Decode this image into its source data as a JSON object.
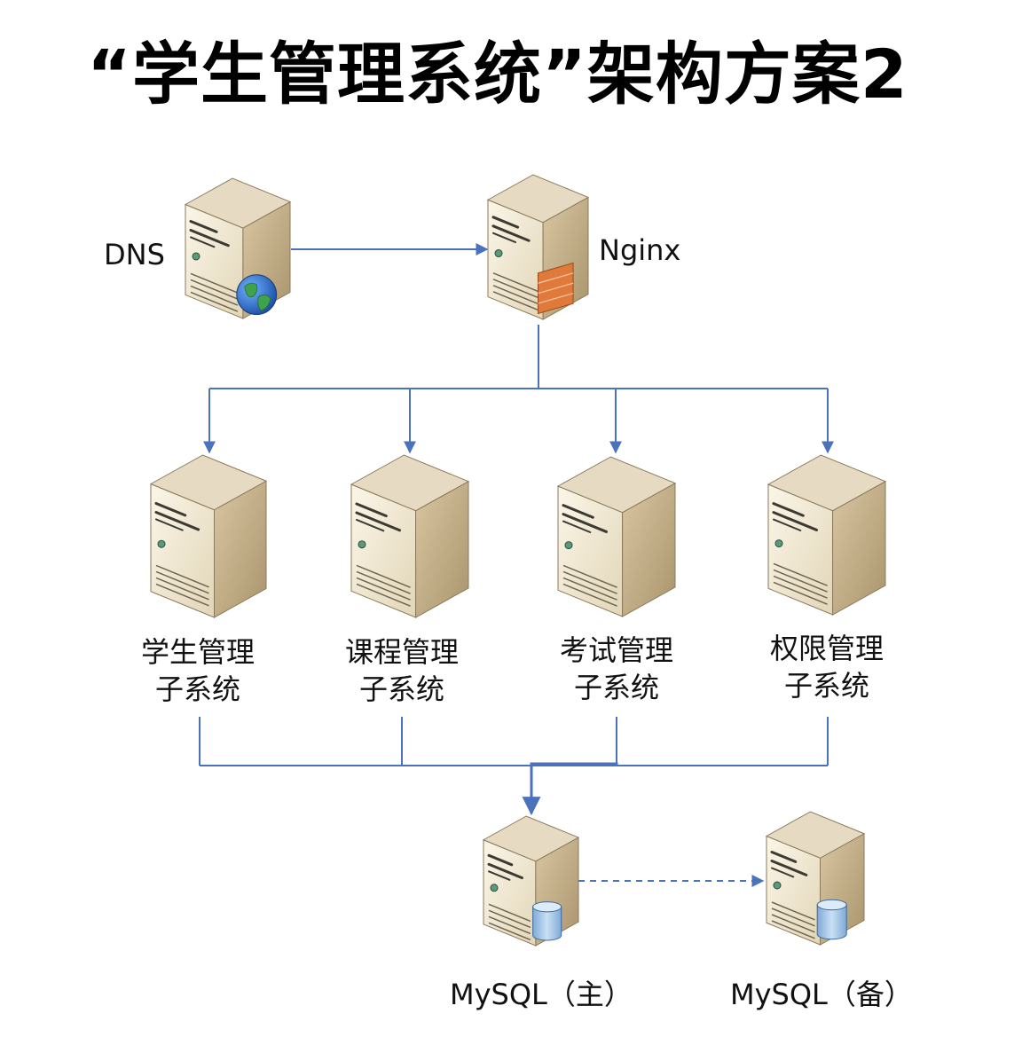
{
  "title": "“学生管理系统”架构方案2",
  "colors": {
    "connector": "#4a72bd",
    "server_front": "#f3ecd9",
    "server_side": "#c8b48e",
    "server_top": "#e6dbc2",
    "server_outline": "#8a7a5c",
    "firewall": "#e07a3a",
    "globe": "#2f6fcf",
    "database": "#9ec3e6"
  },
  "nodes": {
    "dns": {
      "label": "DNS",
      "icon": "globe-icon"
    },
    "nginx": {
      "label": "Nginx",
      "icon": "firewall-icon"
    },
    "subsystems": [
      {
        "line1": "学生管理",
        "line2": "子系统"
      },
      {
        "line1": "课程管理",
        "line2": "子系统"
      },
      {
        "line1": "考试管理",
        "line2": "子系统"
      },
      {
        "line1": "权限管理",
        "line2": "子系统"
      }
    ],
    "mysql_main": {
      "label": "MySQL（主）",
      "icon": "database-icon"
    },
    "mysql_backup": {
      "label": "MySQL（备）",
      "icon": "database-icon"
    }
  }
}
